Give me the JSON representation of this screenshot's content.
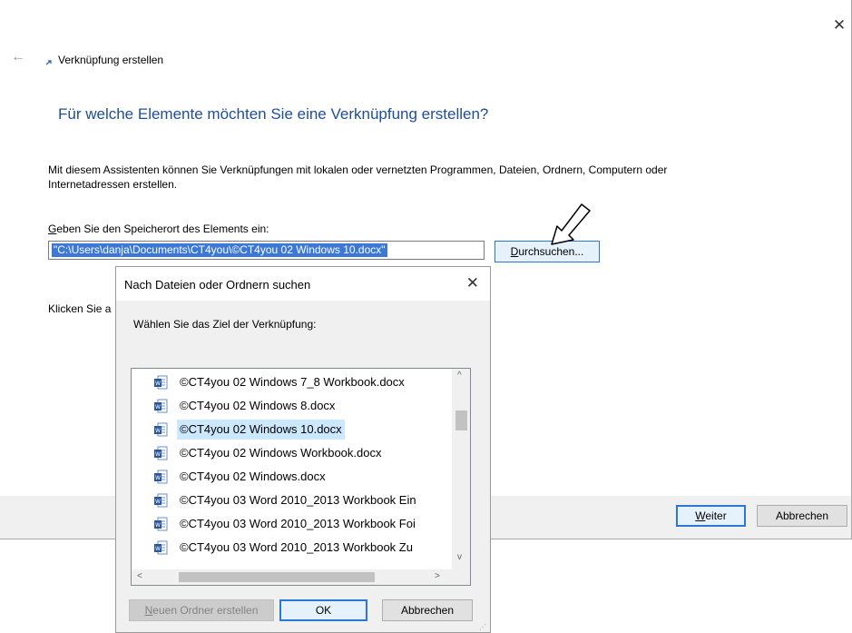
{
  "wizard": {
    "back_arrow": "←",
    "title": "Verknüpfung erstellen",
    "close": "✕",
    "heading": "Für welche Elemente möchten Sie eine Verknüpfung erstellen?",
    "description": "Mit diesem Assistenten können Sie Verknüpfungen mit lokalen oder vernetzten Programmen, Dateien, Ordnern, Computern oder Internetadressen erstellen.",
    "location_label_accel": "G",
    "location_label_rest": "eben Sie den Speicherort des Elements ein:",
    "location_value": "\"C:\\Users\\danja\\Documents\\CT4you\\©CT4you 02 Windows 10.docx\"",
    "browse_accel": "D",
    "browse_rest": "urchsuchen...",
    "klicken_text": "Klicken Sie a",
    "next_accel": "W",
    "next_rest": "eiter",
    "cancel_label": "Abbrechen"
  },
  "browse_dialog": {
    "title": "Nach Dateien oder Ordnern suchen",
    "close": "✕",
    "prompt": "Wählen Sie das Ziel der Verknüpfung:",
    "items": [
      {
        "label": "©CT4you 02 Windows 7_8 Workbook.docx",
        "selected": false
      },
      {
        "label": "©CT4you 02 Windows 8.docx",
        "selected": false
      },
      {
        "label": "©CT4you 02 Windows 10.docx",
        "selected": true
      },
      {
        "label": "©CT4you 02 Windows Workbook.docx",
        "selected": false
      },
      {
        "label": "©CT4you 02 Windows.docx",
        "selected": false
      },
      {
        "label": "©CT4you 03 Word 2010_2013 Workbook Ein",
        "selected": false
      },
      {
        "label": "©CT4you 03 Word 2010_2013 Workbook Foi",
        "selected": false
      },
      {
        "label": "©CT4you 03 Word 2010_2013 Workbook Zu",
        "selected": false
      }
    ],
    "new_folder_accel": "N",
    "new_folder_rest": "euen Ordner erstellen",
    "ok_label": "OK",
    "cancel_label": "Abbrechen",
    "scroll_up": "^",
    "scroll_down": "v",
    "scroll_left": "<",
    "scroll_right": ">"
  },
  "colors": {
    "heading": "#1e4e9a",
    "selection": "#3c78d8",
    "tree_selection": "#cce8ff",
    "accent_border": "#2a78d4"
  }
}
